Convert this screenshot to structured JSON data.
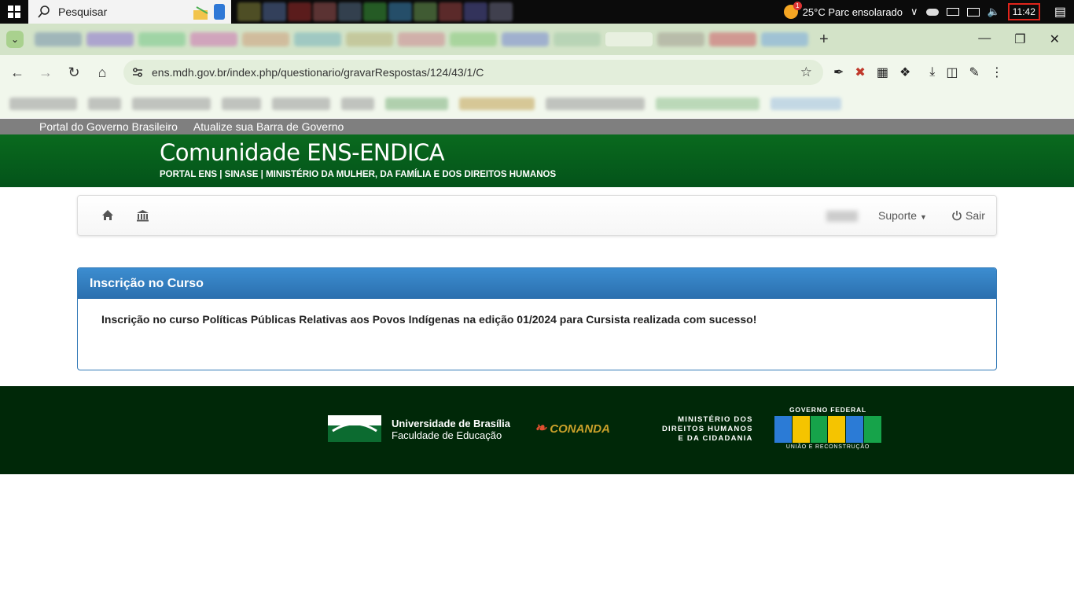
{
  "taskbar": {
    "search_placeholder": "Pesquisar",
    "weather": "25°C  Parc ensolarado",
    "notification_badge": "1",
    "clock": "11:42"
  },
  "browser": {
    "url": "ens.mdh.gov.br/index.php/questionario/gravarRespostas/124/43/1/C",
    "new_tab": "+"
  },
  "gov_bar": {
    "portal_link": "Portal do Governo Brasileiro",
    "update_link": "Atualize sua Barra de Governo"
  },
  "header": {
    "title": "Comunidade ENS-ENDICA",
    "subtitle": "PORTAL ENS | SINASE | MINISTÉRIO DA MULHER, DA FAMÍLIA E DOS DIREITOS HUMANOS"
  },
  "navbar": {
    "support_label": "Suporte",
    "logout_label": "Sair"
  },
  "panel": {
    "title": "Inscrição no Curso",
    "message": "Inscrição no curso Políticas Públicas Relativas aos Povos Indígenas na edição 01/2024 para Cursista realizada com sucesso!"
  },
  "footer": {
    "unb_name": "Universidade de Brasília",
    "unb_faculty": "Faculdade de Educação",
    "conanda": "CONANDA",
    "ministry_line1": "MINISTÉRIO DOS",
    "ministry_line2": "DIREITOS HUMANOS",
    "ministry_line3": "E DA CIDADANIA",
    "gov_top": "GOVERNO FEDERAL",
    "gov_bottom": "UNIÃO E RECONSTRUÇÃO"
  },
  "colors": {
    "header_green": "#03531a",
    "panel_blue": "#337ab7",
    "footer_dark": "#002808",
    "clock_highlight": "#e0241b"
  }
}
